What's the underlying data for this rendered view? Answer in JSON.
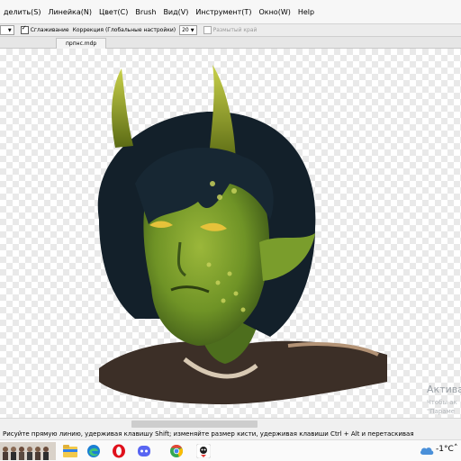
{
  "menubar": {
    "items": [
      "делить(S)",
      "Линейка(N)",
      "Цвет(C)",
      "Brush",
      "Вид(V)",
      "Инструмент(T)",
      "Окно(W)",
      "Help"
    ]
  },
  "options": {
    "dropdown_left": "0",
    "smoothing_label": "Сглаживание",
    "smoothing_checked": true,
    "correction_label": "Коррекция (Глобальные настройки)",
    "correction_value": "20",
    "blur_edge_label": "Размытый край",
    "blur_edge_checked": false
  },
  "document": {
    "tab_name": "прпнс.mdp"
  },
  "canvas": {
    "watermark": "Актива",
    "watermark_sub1": "Чтобы ак",
    "watermark_sub2": "\"Параме"
  },
  "statusbar": {
    "text": "Рисуйте прямую линию, удерживая клавишу Shift; изменяйте размер кисти, удерживая клавиши Ctrl + Alt и перетаскивая"
  },
  "taskbar": {
    "apps": [
      "file-explorer-icon",
      "edge-icon",
      "opera-icon",
      "discord-icon",
      "chrome-icon",
      "medibang-icon"
    ],
    "temperature": "-1°C",
    "colors": {
      "opera": "#e0101b",
      "discord": "#5865f2",
      "edge": "#1a7fd4",
      "chrome_green": "#34a853"
    }
  }
}
